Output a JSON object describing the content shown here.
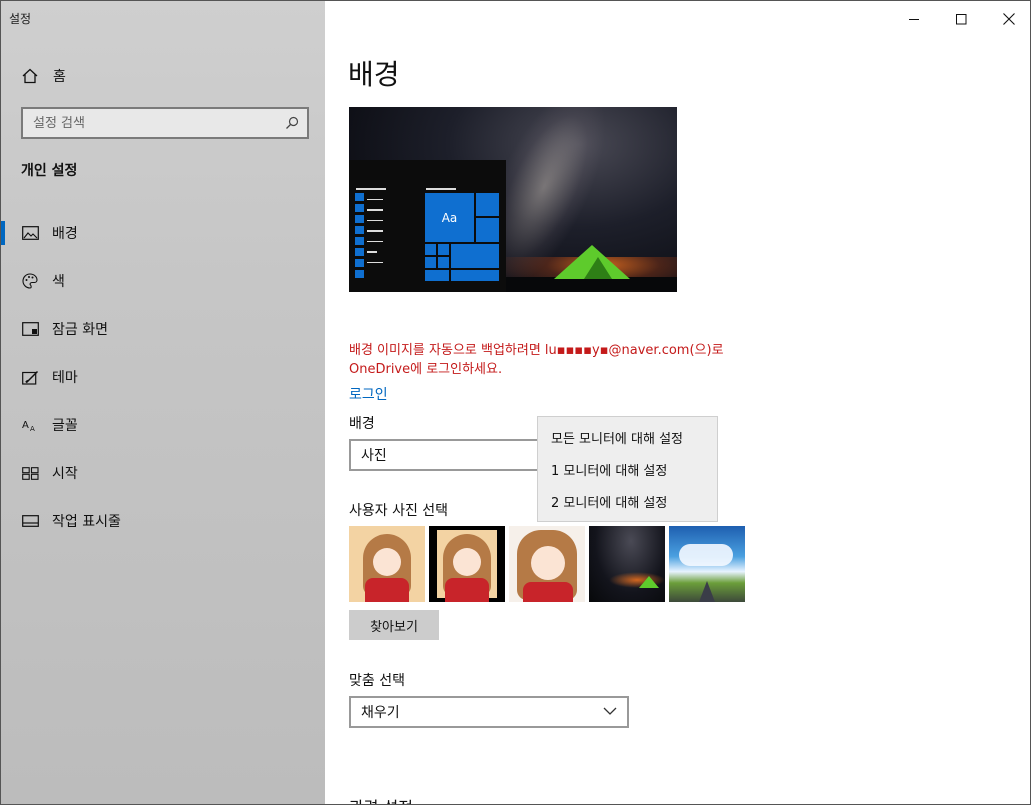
{
  "window": {
    "title": "설정"
  },
  "sidebar": {
    "home_label": "홈",
    "search_placeholder": "설정 검색",
    "section_heading": "개인 설정",
    "items": [
      {
        "label": "배경",
        "icon": "image-icon",
        "active": true
      },
      {
        "label": "색",
        "icon": "palette-icon",
        "active": false
      },
      {
        "label": "잠금 화면",
        "icon": "lock-screen-icon",
        "active": false
      },
      {
        "label": "테마",
        "icon": "theme-icon",
        "active": false
      },
      {
        "label": "글꼴",
        "icon": "font-icon",
        "active": false
      },
      {
        "label": "시작",
        "icon": "start-icon",
        "active": false
      },
      {
        "label": "작업 표시줄",
        "icon": "taskbar-icon",
        "active": false
      }
    ]
  },
  "main": {
    "title": "배경",
    "preview_tile_text": "Aa",
    "backup_warning": "배경 이미지를 자동으로 백업하려면 lu▪▪▪▪y▪@naver.com(으)로 OneDrive에 로그인하세요.",
    "signin_link": "로그인",
    "background_label": "배경",
    "background_value": "사진",
    "context_menu": [
      "모든 모니터에 대해 설정",
      "1 모니터에 대해 설정",
      "2 모니터에 대해 설정"
    ],
    "choose_picture_label": "사용자 사진 선택",
    "browse_button": "찾아보기",
    "fit_label": "맞춤 선택",
    "fit_value": "채우기",
    "next_heading_partial": "관련 설정"
  },
  "colors": {
    "accent": "#0067c0",
    "warning": "#c41a1a",
    "tile": "#0f6fd0"
  }
}
